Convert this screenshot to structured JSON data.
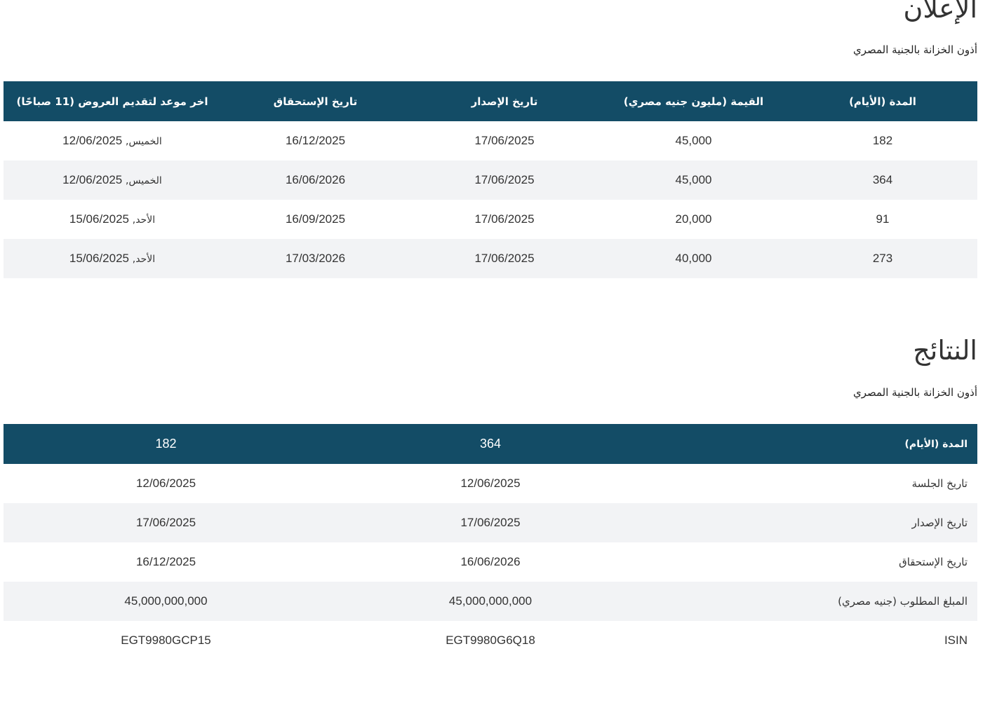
{
  "announcement": {
    "title": "الإعلان",
    "subtitle": "أذون الخزانة بالجنية المصري",
    "headers": {
      "tenor": "المدة (الأيام)",
      "amount": "القيمة (مليون جنيه مصري)",
      "issue_date": "تاريخ الإصدار",
      "maturity_date": "تاريخ الإستحقاق",
      "deadline": "اخر موعد لتقديم العروض (11 صباحًا)"
    },
    "rows": [
      {
        "tenor": "182",
        "amount": "45,000",
        "issue_date": "17/06/2025",
        "maturity_date": "16/12/2025",
        "deadline_day": "الخميس,",
        "deadline_date": "12/06/2025"
      },
      {
        "tenor": "364",
        "amount": "45,000",
        "issue_date": "17/06/2025",
        "maturity_date": "16/06/2026",
        "deadline_day": "الخميس,",
        "deadline_date": "12/06/2025"
      },
      {
        "tenor": "91",
        "amount": "20,000",
        "issue_date": "17/06/2025",
        "maturity_date": "16/09/2025",
        "deadline_day": "الأحد,",
        "deadline_date": "15/06/2025"
      },
      {
        "tenor": "273",
        "amount": "40,000",
        "issue_date": "17/06/2025",
        "maturity_date": "17/03/2026",
        "deadline_day": "الأحد,",
        "deadline_date": "15/06/2025"
      }
    ]
  },
  "results": {
    "title": "النتائج",
    "subtitle": "أذون الخزانة بالجنية المصري",
    "header": {
      "label": "المدة (الأيام)",
      "col1": "364",
      "col2": "182"
    },
    "rows": [
      {
        "label": "تاريخ الجلسة",
        "col1": "12/06/2025",
        "col2": "12/06/2025"
      },
      {
        "label": "تاريخ الإصدار",
        "col1": "17/06/2025",
        "col2": "17/06/2025"
      },
      {
        "label": "تاريخ الإستحقاق",
        "col1": "16/06/2026",
        "col2": "16/12/2025"
      },
      {
        "label": "المبلغ المطلوب (جنيه مصري)",
        "col1": "45,000,000,000",
        "col2": "45,000,000,000"
      },
      {
        "label": "ISIN",
        "col1": "EGT9980G6Q18",
        "col2": "EGT9980GCP15"
      }
    ]
  }
}
